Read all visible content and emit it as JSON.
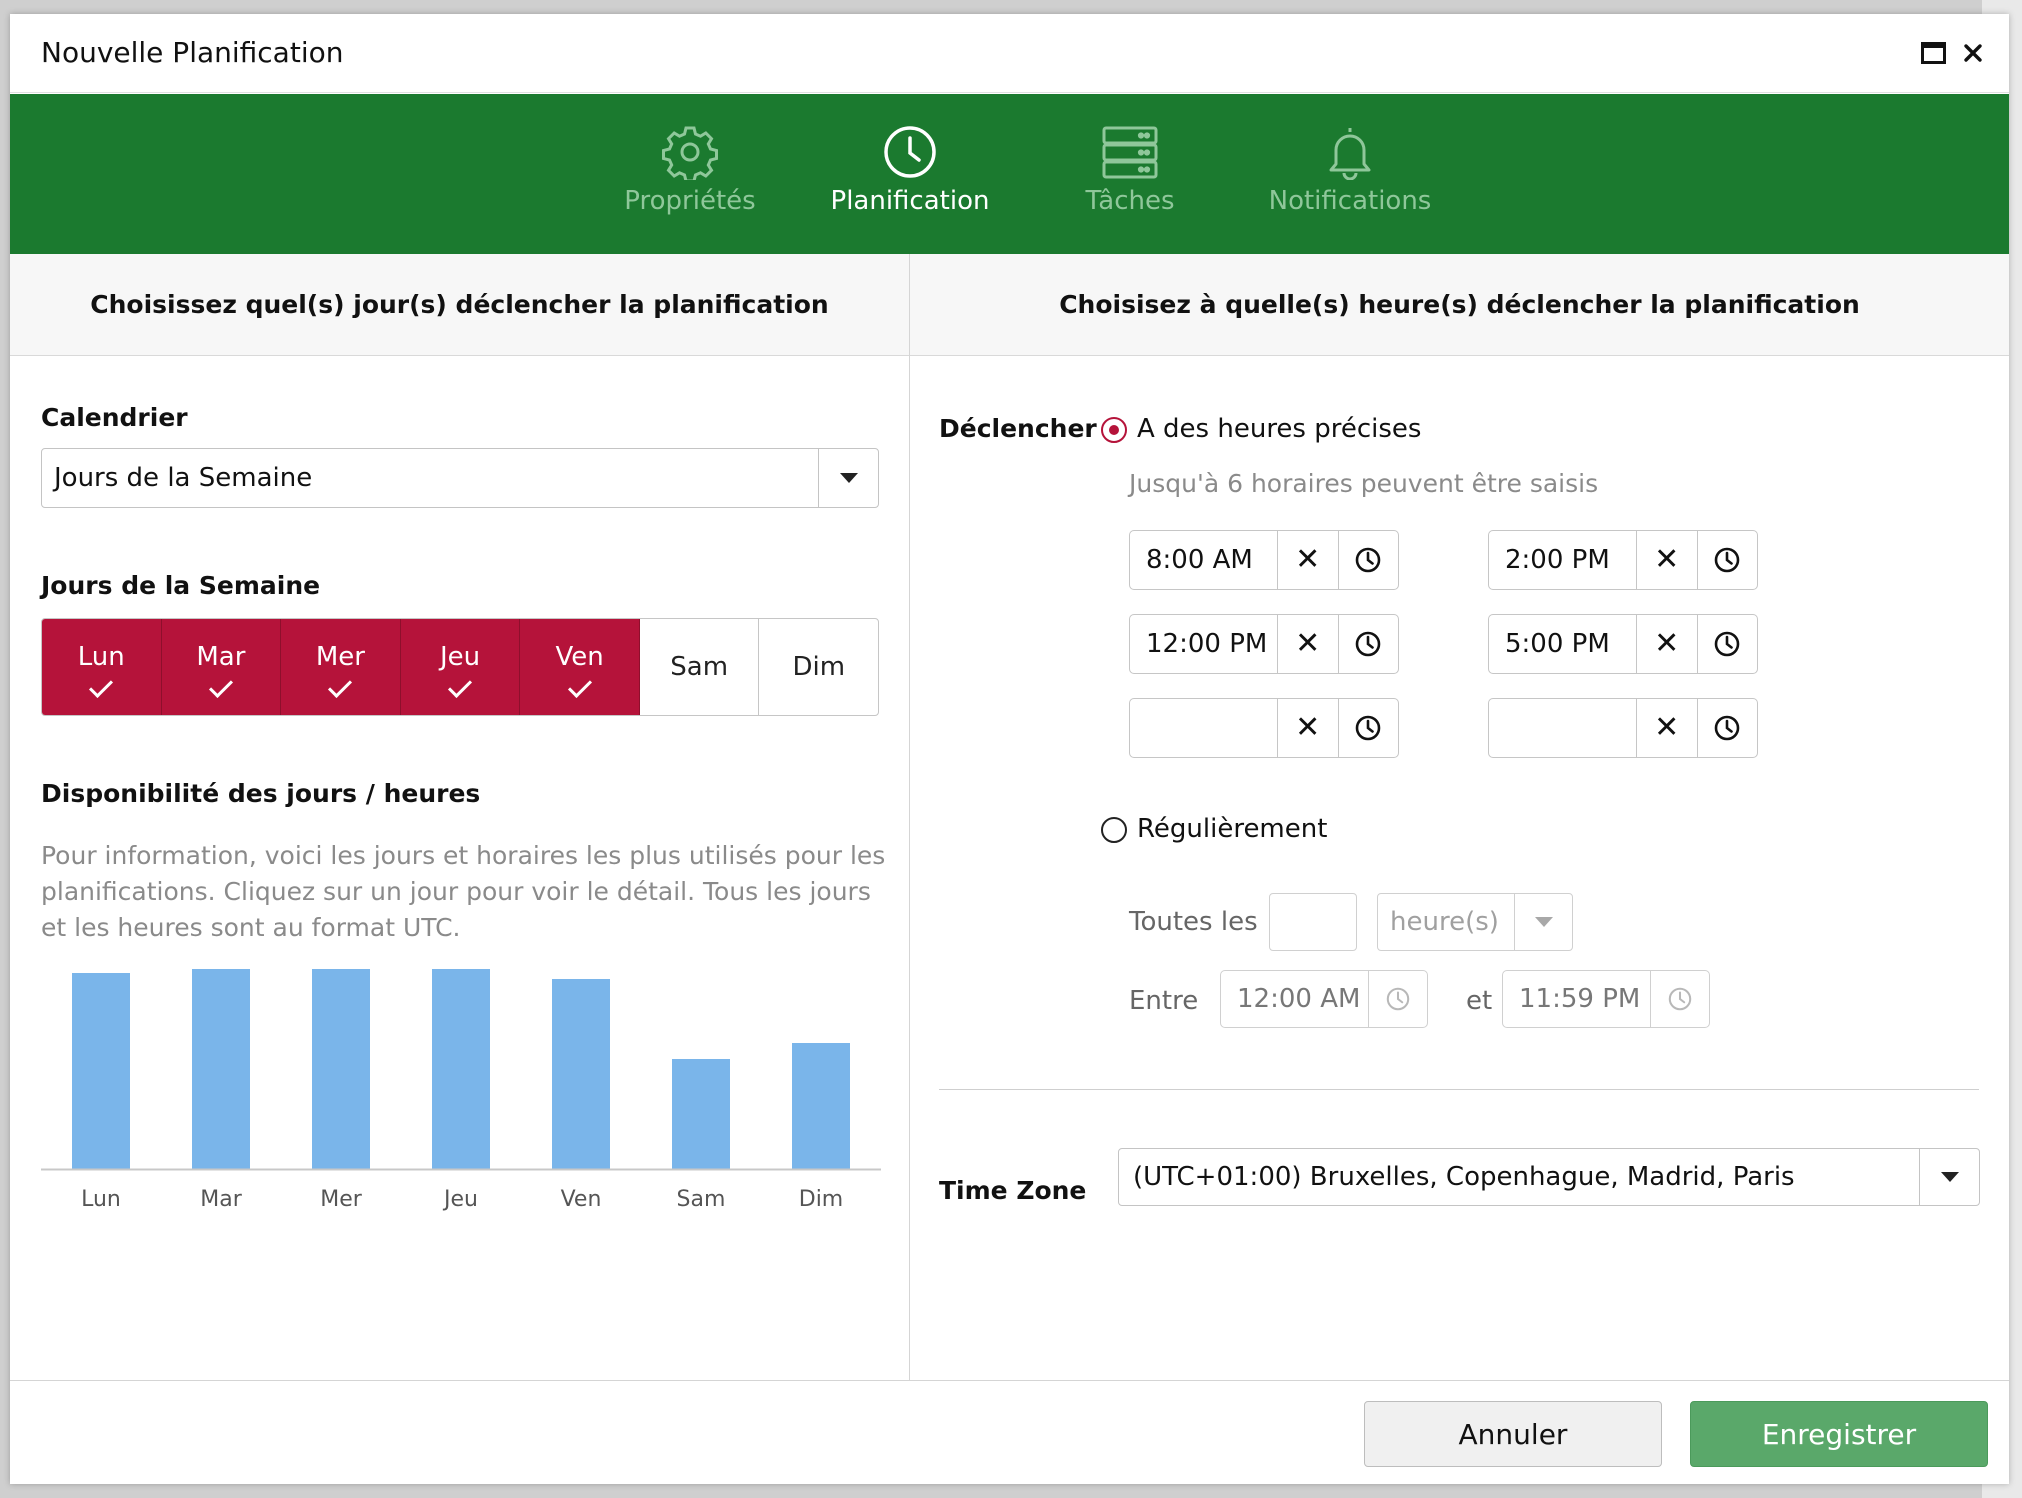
{
  "dialog": {
    "title": "Nouvelle Planification"
  },
  "steps": [
    {
      "label": "Propriétés",
      "icon": "gear-icon",
      "active": false
    },
    {
      "label": "Planification",
      "icon": "clock-icon",
      "active": true
    },
    {
      "label": "Tâches",
      "icon": "server-icon",
      "active": false
    },
    {
      "label": "Notifications",
      "icon": "bell-icon",
      "active": false
    }
  ],
  "left": {
    "header": "Choisissez quel(s) jour(s) déclencher la planification",
    "calendar_label": "Calendrier",
    "calendar_value": "Jours de la Semaine",
    "weekdays_label": "Jours de la Semaine",
    "days": [
      {
        "label": "Lun",
        "selected": true
      },
      {
        "label": "Mar",
        "selected": true
      },
      {
        "label": "Mer",
        "selected": true
      },
      {
        "label": "Jeu",
        "selected": true
      },
      {
        "label": "Ven",
        "selected": true
      },
      {
        "label": "Sam",
        "selected": false
      },
      {
        "label": "Dim",
        "selected": false
      }
    ],
    "availability_title": "Disponibilité des jours / heures",
    "availability_desc": "Pour information, voici les jours et horaires les plus utilisés pour les planifications. Cliquez sur un jour pour voir le détail. Tous les jours et les heures sont au format UTC."
  },
  "chart_data": {
    "type": "bar",
    "categories": [
      "Lun",
      "Mar",
      "Mer",
      "Jeu",
      "Ven",
      "Sam",
      "Dim"
    ],
    "values": [
      98,
      100,
      100,
      100,
      95,
      55,
      63
    ],
    "ylim": [
      0,
      100
    ],
    "bar_color": "#7ab5ea",
    "grid": false
  },
  "right": {
    "header": "Choisisez à quelle(s) heure(s) déclencher la planification",
    "trigger_label": "Déclencher",
    "option_precise": "A des heures précises",
    "precise_hint": "Jusqu'à 6 horaires peuvent être saisis",
    "times": [
      "8:00 AM",
      "2:00 PM",
      "12:00 PM",
      "5:00 PM",
      "",
      ""
    ],
    "option_regular": "Régulièrement",
    "every_label": "Toutes les",
    "every_value": "",
    "unit_value": "heure(s)",
    "between_label": "Entre",
    "between_start": "12:00 AM",
    "and_label": "et",
    "between_end": "11:59 PM",
    "timezone_label": "Time Zone",
    "timezone_value": "(UTC+01:00) Bruxelles, Copenhague, Madrid, Paris"
  },
  "footer": {
    "cancel": "Annuler",
    "save": "Enregistrer"
  },
  "colors": {
    "brand_green": "#1b7a2f",
    "day_selected": "#b5133a",
    "save_button": "#5aa86a"
  }
}
